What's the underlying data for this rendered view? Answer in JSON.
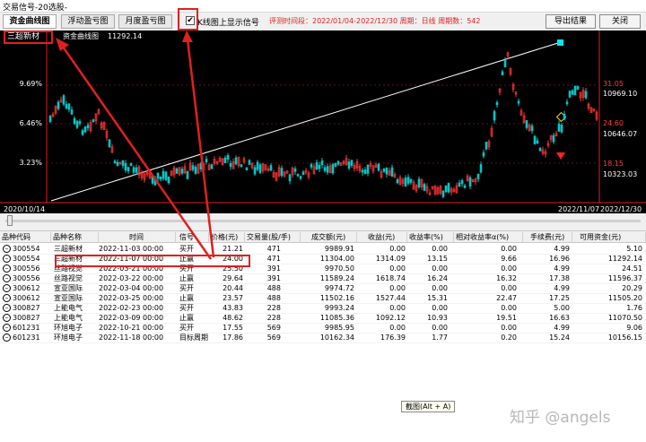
{
  "window": {
    "title": "交易信号-20选股-"
  },
  "toolbar": {
    "tabs": [
      {
        "label": "资金曲线图",
        "active": true
      },
      {
        "label": "浮动盈亏图",
        "active": false
      },
      {
        "label": "月度盈亏图",
        "active": false
      }
    ],
    "checkbox_checked": true,
    "checkbox_label": "K线图上显示信号",
    "range_info": "评测时间段：2022/01/04-2022/12/30 周期：日线 周期数：542",
    "export_label": "导出结果",
    "close_label": "关闭"
  },
  "chart": {
    "stock_name": "三超新材",
    "equity_label": "资金曲线图",
    "equity_value": "11292.14",
    "left_axis": [
      "9.69%",
      "6.46%",
      "3.23%"
    ],
    "right_axis": [
      "31.05",
      "10969.10",
      "24.60",
      "10646.07",
      "18.15",
      "10323.03"
    ],
    "date_left": "2020/10/14",
    "date_mid": "2022/11/07",
    "date_right": "2022/12/30",
    "colors": {
      "up": "#ff3333",
      "down": "#00c8c8",
      "axis": "#e02020",
      "equity": "#ffffff"
    }
  },
  "table": {
    "headers": [
      "品种代码",
      "品种名称",
      "时间",
      "信号",
      "价格(元)",
      "交易量(股/手)",
      "成交额(元)",
      "收益(元)",
      "收益率(%)",
      "相对收益率α(%)",
      "手续费(元)",
      "可用资金(元)"
    ],
    "rows": [
      [
        "300554",
        "三超新材",
        "2022-11-03 00:00",
        "买开",
        "21.21",
        "471",
        "9989.91",
        "0.00",
        "0.00",
        "0.00",
        "4.99",
        "5.10"
      ],
      [
        "300554",
        "三超新材",
        "2022-11-07 00:00",
        "止赢",
        "24.00",
        "471",
        "11304.00",
        "1314.09",
        "13.15",
        "9.66",
        "16.96",
        "11292.14"
      ],
      [
        "300556",
        "丝路视觉",
        "2022-03-21 00:00",
        "买开",
        "25.50",
        "391",
        "9970.50",
        "0.00",
        "0.00",
        "0.00",
        "4.99",
        "24.51"
      ],
      [
        "300556",
        "丝路视觉",
        "2022-03-22 00:00",
        "止赢",
        "29.64",
        "391",
        "11589.24",
        "1618.74",
        "16.24",
        "16.32",
        "17.38",
        "11596.37"
      ],
      [
        "300612",
        "宣亚国际",
        "2022-03-04 00:00",
        "买开",
        "20.44",
        "488",
        "9974.72",
        "0.00",
        "0.00",
        "0.00",
        "4.99",
        "20.29"
      ],
      [
        "300612",
        "宣亚国际",
        "2022-03-25 00:00",
        "止赢",
        "23.57",
        "488",
        "11502.16",
        "1527.44",
        "15.31",
        "22.47",
        "17.25",
        "11505.20"
      ],
      [
        "300827",
        "上能电气",
        "2022-02-23 00:00",
        "买开",
        "43.83",
        "228",
        "9993.24",
        "0.00",
        "0.00",
        "0.00",
        "5.00",
        "1.76"
      ],
      [
        "300827",
        "上能电气",
        "2022-03-09 00:00",
        "止赢",
        "48.62",
        "228",
        "11085.36",
        "1092.12",
        "10.93",
        "19.51",
        "16.63",
        "11070.50"
      ],
      [
        "601231",
        "环旭电子",
        "2022-10-21 00:00",
        "买开",
        "17.55",
        "569",
        "9985.95",
        "0.00",
        "0.00",
        "0.00",
        "4.99",
        "9.06"
      ],
      [
        "601231",
        "环旭电子",
        "2022-11-18 00:00",
        "目标周期",
        "17.86",
        "569",
        "10162.34",
        "176.39",
        "1.77",
        "0.20",
        "15.24",
        "10156.15"
      ]
    ]
  },
  "tooltip": "截图(Alt + A)",
  "watermark": "知乎 @angels"
}
